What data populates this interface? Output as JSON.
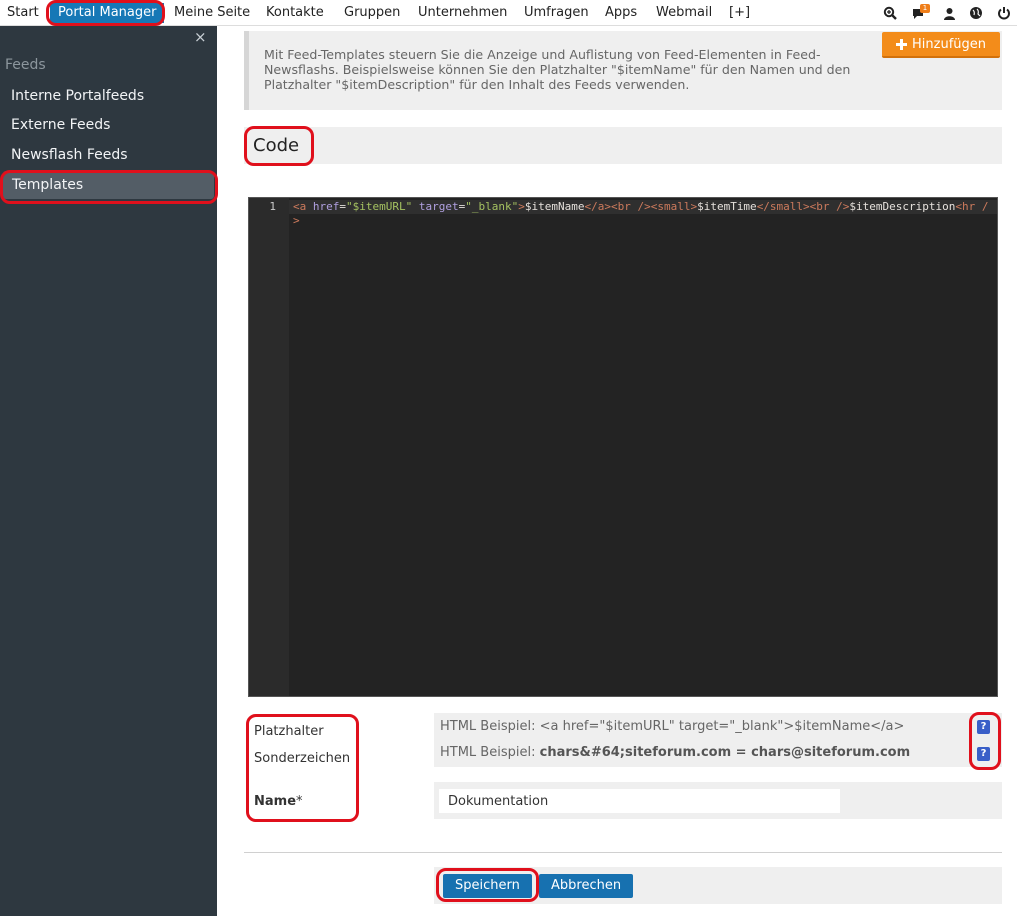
{
  "nav": {
    "items": [
      {
        "label": "Start"
      },
      {
        "label": "Portal Manager",
        "active": true
      },
      {
        "label": "Meine Seite"
      },
      {
        "label": "Kontakte"
      },
      {
        "label": "Gruppen"
      },
      {
        "label": "Unternehmen"
      },
      {
        "label": "Umfragen"
      },
      {
        "label": "Apps"
      },
      {
        "label": "Webmail"
      },
      {
        "label": "[+]"
      }
    ],
    "notification_count": "1",
    "icons": [
      "search-zoom-icon",
      "chat-icon",
      "user-icon",
      "globe-icon",
      "power-icon"
    ]
  },
  "sidebar": {
    "close_glyph": "×",
    "section": "Feeds",
    "items": [
      {
        "label": "Interne Portalfeeds"
      },
      {
        "label": "Externe Feeds"
      },
      {
        "label": "Newsflash Feeds"
      },
      {
        "label": "Templates",
        "active": true
      }
    ]
  },
  "info": {
    "text": "Mit Feed-Templates steuern Sie die Anzeige und Auflistung von Feed-Elementen in Feed-Newsflashs. Beispielsweise können Sie den Platzhalter \"$itemName\" für den Namen und den Platzhalter \"$itemDescription\" für den Inhalt des Feeds verwenden.",
    "add_button": "Hinzufügen"
  },
  "code_section": {
    "title": "Code",
    "line_number": "1",
    "code": "<a href=\"$itemURL\" target=\"_blank\">$itemName</a><br /><small>$itemTime</small><br />$itemDescription<hr />"
  },
  "form": {
    "placeholder_label": "Platzhalter",
    "special_chars_label": "Sonderzeichen",
    "name_label": "Name",
    "required_mark": "*",
    "placeholder_example_prefix": "HTML Beispiel: ",
    "placeholder_example": "<a href=\"$itemURL\" target=\"_blank\">$itemName</a>",
    "special_example_prefix": "HTML Beispiel: ",
    "special_example": "chars&#64;siteforum.com = chars@siteforum.com",
    "help_glyph": "?",
    "name_value": "Dokumentation"
  },
  "actions": {
    "save": "Speichern",
    "cancel": "Abbrechen"
  },
  "colors": {
    "accent": "#1678b6",
    "sidebar": "#2e3840",
    "add_button": "#f38c1a",
    "highlight": "#e0101c"
  }
}
